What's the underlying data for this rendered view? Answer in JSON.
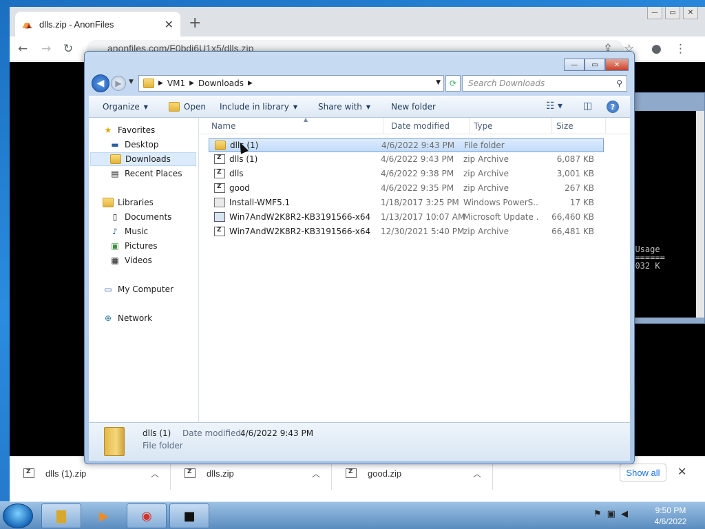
{
  "browser": {
    "tab_title": "dlls.zip - AnonFiles",
    "url": "anonfiles.com/F0bdi6U1x5/dlls.zip"
  },
  "cmd_window": {
    "text": "m Usage\n========\n4,032 K"
  },
  "explorer": {
    "breadcrumb": [
      "VM1",
      "Downloads"
    ],
    "search_placeholder": "Search Downloads",
    "commands": {
      "organize": "Organize",
      "open": "Open",
      "include": "Include in library",
      "share": "Share with",
      "newfolder": "New folder"
    },
    "nav": {
      "favorites": "Favorites",
      "desktop": "Desktop",
      "downloads": "Downloads",
      "recent": "Recent Places",
      "libraries": "Libraries",
      "documents": "Documents",
      "music": "Music",
      "pictures": "Pictures",
      "videos": "Videos",
      "computer": "My Computer",
      "network": "Network"
    },
    "columns": {
      "name": "Name",
      "date": "Date modified",
      "type": "Type",
      "size": "Size"
    },
    "files": [
      {
        "name": "dlls (1)",
        "date": "4/6/2022 9:43 PM",
        "type": "File folder",
        "size": ""
      },
      {
        "name": "dlls (1)",
        "date": "4/6/2022 9:43 PM",
        "type": "zip Archive",
        "size": "6,087 KB"
      },
      {
        "name": "dlls",
        "date": "4/6/2022 9:38 PM",
        "type": "zip Archive",
        "size": "3,001 KB"
      },
      {
        "name": "good",
        "date": "4/6/2022 9:35 PM",
        "type": "zip Archive",
        "size": "267 KB"
      },
      {
        "name": "Install-WMF5.1",
        "date": "1/18/2017 3:25 PM",
        "type": "Windows PowerS...",
        "size": "17 KB"
      },
      {
        "name": "Win7AndW2K8R2-KB3191566-x64",
        "date": "1/13/2017 10:07 AM",
        "type": "Microsoft Update ...",
        "size": "66,460 KB"
      },
      {
        "name": "Win7AndW2K8R2-KB3191566-x64",
        "date": "12/30/2021 5:40 PM",
        "type": "zip Archive",
        "size": "66,481 KB"
      }
    ],
    "details": {
      "name": "dlls (1)",
      "date_label": "Date modified:",
      "date": "4/6/2022 9:43 PM",
      "type": "File folder"
    }
  },
  "downloads": {
    "items": [
      "dlls (1).zip",
      "dlls.zip",
      "good.zip"
    ],
    "show_all": "Show all"
  },
  "taskbar": {
    "time": "9:50 PM",
    "date": "4/6/2022"
  }
}
